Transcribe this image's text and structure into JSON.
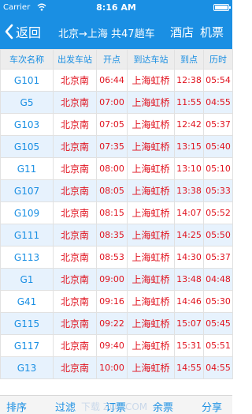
{
  "status": {
    "carrier": "Carrier",
    "time": "8:16 AM"
  },
  "nav": {
    "back_label": "返回",
    "title": "北京→上海 共47趟车",
    "hotel": "酒店",
    "ticket": "机票"
  },
  "columns": [
    "车次名称",
    "出发车站",
    "开点",
    "到达车站",
    "到点",
    "历时"
  ],
  "rows": [
    [
      "G101",
      "北京南",
      "06:44",
      "上海虹桥",
      "12:38",
      "05:54"
    ],
    [
      "G5",
      "北京南",
      "07:00",
      "上海虹桥",
      "11:55",
      "04:55"
    ],
    [
      "G103",
      "北京南",
      "07:05",
      "上海虹桥",
      "12:42",
      "05:37"
    ],
    [
      "G105",
      "北京南",
      "07:35",
      "上海虹桥",
      "13:15",
      "05:40"
    ],
    [
      "G11",
      "北京南",
      "08:00",
      "上海虹桥",
      "13:10",
      "05:10"
    ],
    [
      "G107",
      "北京南",
      "08:05",
      "上海虹桥",
      "13:38",
      "05:33"
    ],
    [
      "G109",
      "北京南",
      "08:15",
      "上海虹桥",
      "14:07",
      "05:52"
    ],
    [
      "G111",
      "北京南",
      "08:35",
      "上海虹桥",
      "14:25",
      "05:50"
    ],
    [
      "G113",
      "北京南",
      "08:53",
      "上海虹桥",
      "14:30",
      "05:37"
    ],
    [
      "G1",
      "北京南",
      "09:00",
      "上海虹桥",
      "13:48",
      "04:48"
    ],
    [
      "G41",
      "北京南",
      "09:16",
      "上海虹桥",
      "14:46",
      "05:30"
    ],
    [
      "G115",
      "北京南",
      "09:22",
      "上海虹桥",
      "15:07",
      "05:45"
    ],
    [
      "G117",
      "北京南",
      "09:40",
      "上海虹桥",
      "15:31",
      "05:51"
    ],
    [
      "G13",
      "北京南",
      "10:00",
      "上海虹桥",
      "14:55",
      "04:55"
    ]
  ],
  "tabbar": {
    "sort": "排序",
    "filter": "过滤",
    "book": "订票",
    "remaining": "余票",
    "share": "分享",
    "watermark": "下载 ZOL.COM"
  },
  "colors": {
    "accent": "#1a8fe3",
    "red": "#e0121e",
    "stripe": "#e7f2fd"
  }
}
